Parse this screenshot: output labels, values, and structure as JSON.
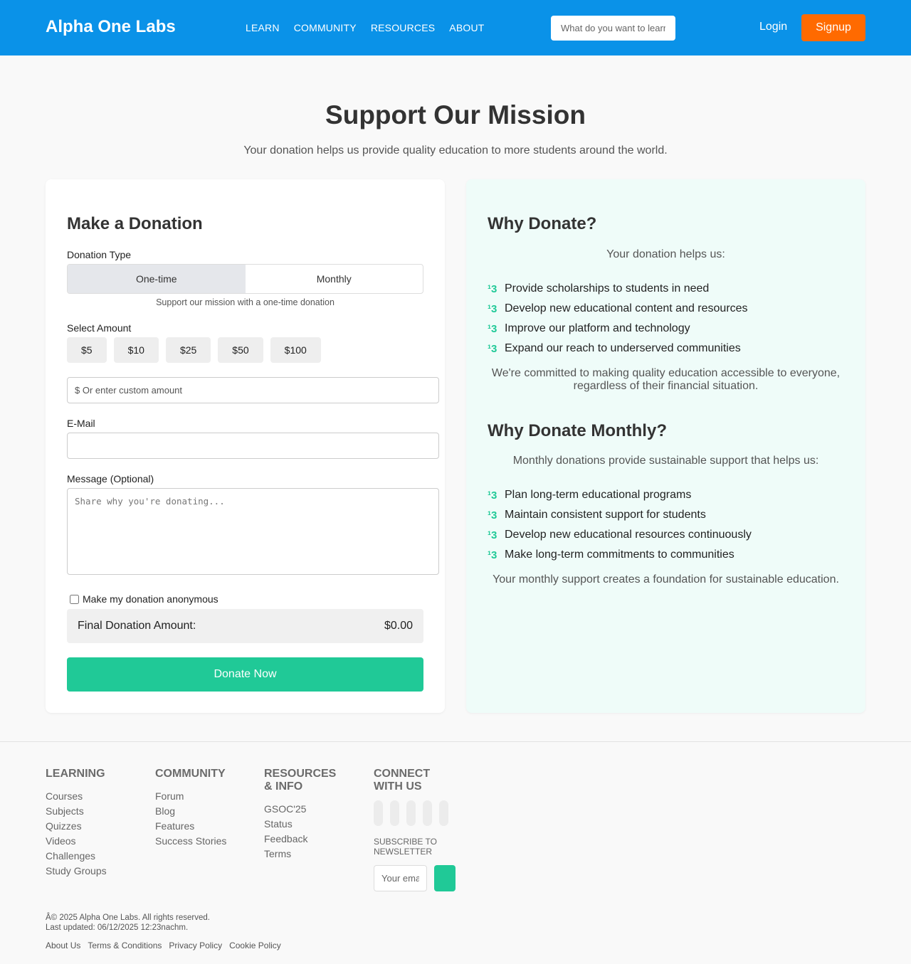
{
  "header": {
    "brand": "Alpha One Labs",
    "nav": [
      "LEARN",
      "COMMUNITY",
      "RESOURCES",
      "ABOUT"
    ],
    "search_placeholder": "What do you want to learn?",
    "login": "Login",
    "signup": "Signup"
  },
  "hero": {
    "title": "Support Our Mission",
    "subtitle": "Your donation helps us provide quality education to more students around the world."
  },
  "donation": {
    "title": "Make a Donation",
    "type_label": "Donation Type",
    "types": [
      "One-time",
      "Monthly"
    ],
    "selected_type": "One-time",
    "type_note": "Support our mission with a one-time donation",
    "amount_label": "Select Amount",
    "amounts": [
      "$5",
      "$10",
      "$25",
      "$50",
      "$100"
    ],
    "custom_placeholder": "$ Or enter custom amount",
    "email_label": "E-Mail",
    "email_value": "",
    "message_label": "Message (Optional)",
    "message_placeholder": "Share why you're donating...",
    "anonymous_label": "Make my donation anonymous",
    "final_label": "Final Donation Amount:",
    "final_value": "$0.00",
    "submit": "Donate Now"
  },
  "why": {
    "title": "Why Donate?",
    "intro": "Your donation helps us:",
    "check_glyph": "¹3",
    "items": [
      "Provide scholarships to students in need",
      "Develop new educational content and resources",
      "Improve our platform and technology",
      "Expand our reach to underserved communities"
    ],
    "note": "We're committed to making quality education accessible to everyone, regardless of their financial situation.",
    "monthly_title": "Why Donate Monthly?",
    "monthly_intro": "Monthly donations provide sustainable support that helps us:",
    "monthly_items": [
      "Plan long-term educational programs",
      "Maintain consistent support for students",
      "Develop new educational resources continuously",
      "Make long-term commitments to communities"
    ],
    "monthly_note": "Your monthly support creates a foundation for sustainable education."
  },
  "footer": {
    "learning": {
      "title": "LEARNING",
      "links": [
        "Courses",
        "Subjects",
        "Quizzes",
        "Videos",
        "Challenges",
        "Study Groups"
      ]
    },
    "community": {
      "title": "COMMUNITY",
      "links": [
        "Forum",
        "Blog",
        "Features",
        "Success Stories"
      ]
    },
    "resources": {
      "title": "RESOURCES & INFO",
      "links": [
        "GSOC'25",
        "Status",
        "Feedback",
        "Terms"
      ]
    },
    "connect": {
      "title": "CONNECT WITH US",
      "subscribe_title": "SUBSCRIBE TO NEWSLETTER",
      "email_placeholder": "Your email"
    },
    "copyright": "Â© 2025 Alpha One Labs. All rights reserved.",
    "updated": "Last updated: 06/12/2025 12:23nachm.",
    "legal": [
      "About Us",
      "Terms & Conditions",
      "Privacy Policy",
      "Cookie Policy"
    ]
  }
}
